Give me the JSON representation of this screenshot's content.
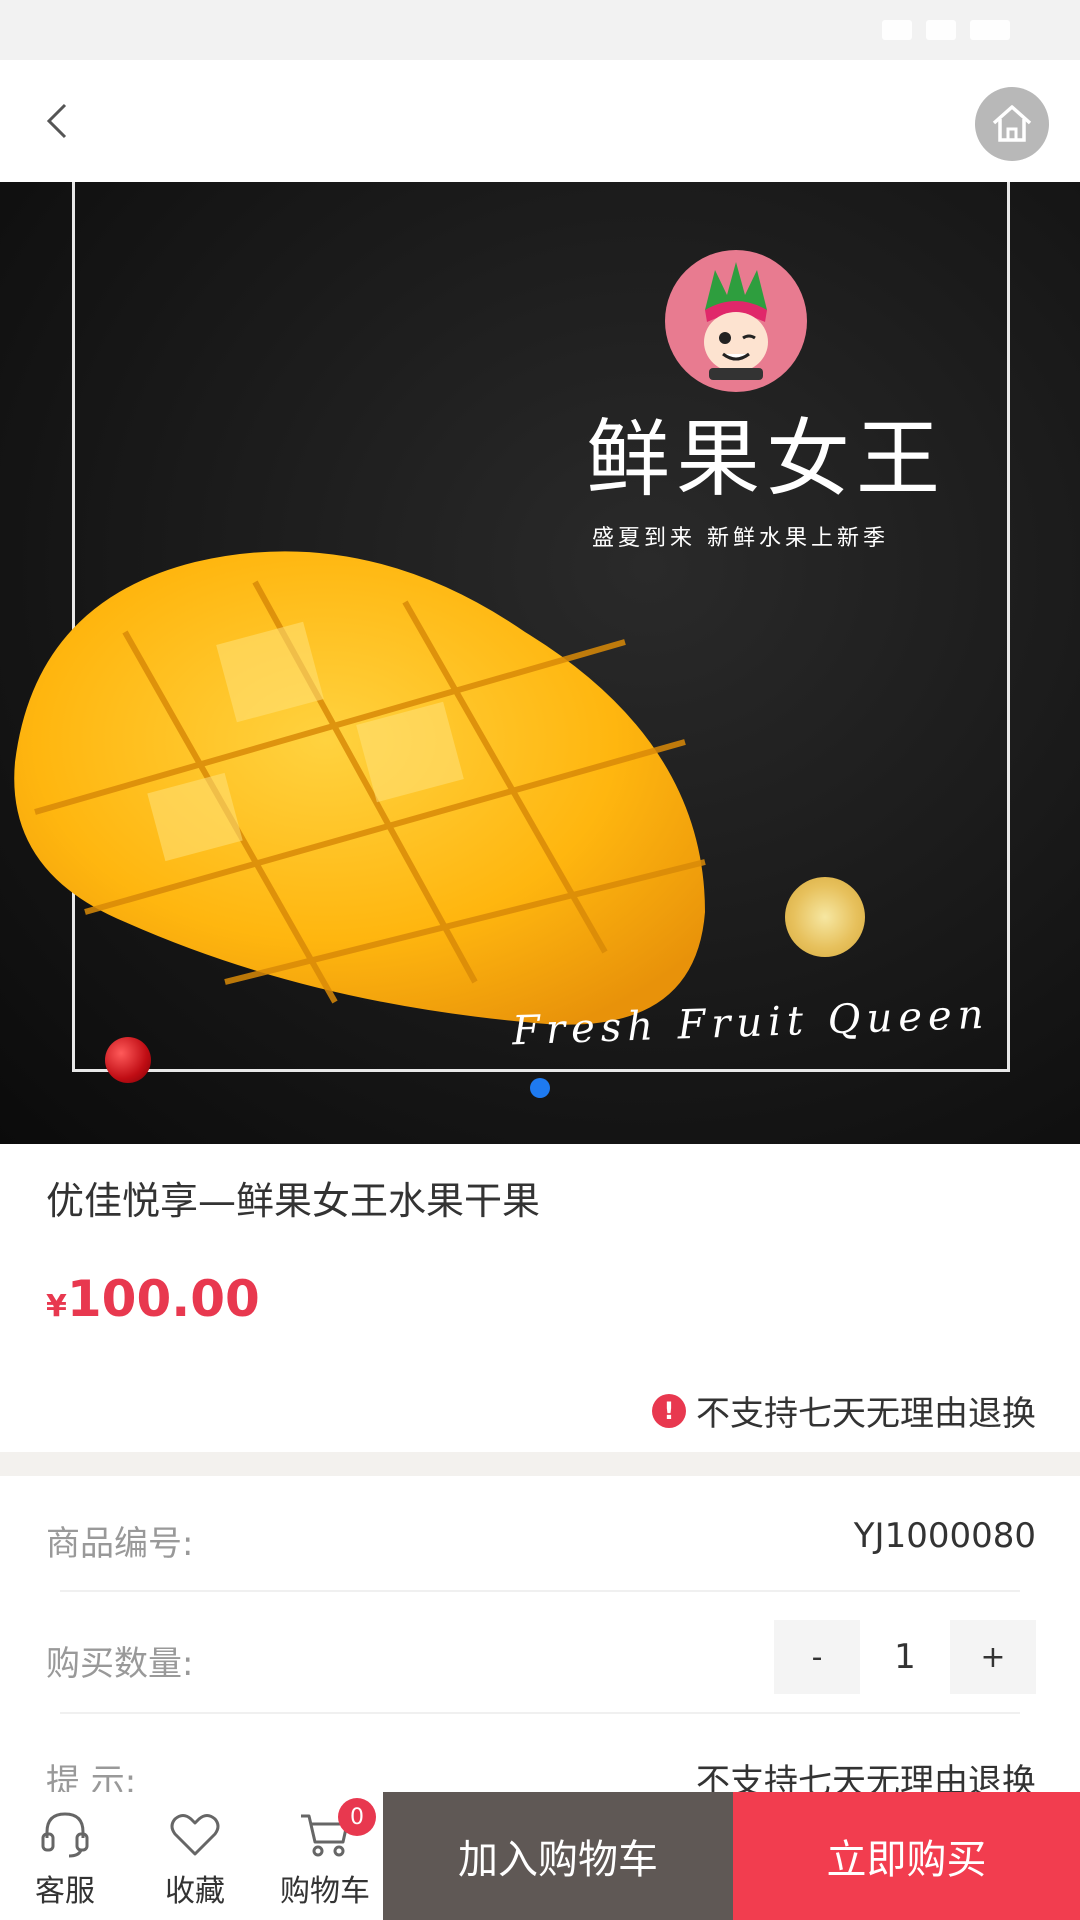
{
  "hero": {
    "brand_title": "鲜果女王",
    "brand_subtitle": "盛夏到来 新鲜水果上新季",
    "brand_english": "Fresh Fruit Queen"
  },
  "product": {
    "title": "优佳悦享—鲜果女王水果干果",
    "currency": "¥",
    "price": "100.00",
    "return_notice": "不支持七天无理由退换"
  },
  "details": {
    "sku_label": "商品编号:",
    "sku_value": "YJ1000080",
    "qty_label": "购买数量:",
    "qty_minus": "-",
    "qty_value": "1",
    "qty_plus": "+",
    "tip_label": "提 示:",
    "tip_value": "不支持七天无理由退换"
  },
  "bottom_bar": {
    "service_label": "客服",
    "favorite_label": "收藏",
    "cart_label": "购物车",
    "cart_count": "0",
    "add_to_cart": "加入购物车",
    "buy_now": "立即购买"
  },
  "colors": {
    "accent_red": "#e8384f",
    "buy_button": "#f23d4f",
    "cart_button": "#5f5855"
  },
  "icons": [
    "back-icon",
    "home-icon",
    "warning-icon",
    "headset-icon",
    "heart-icon",
    "cart-icon"
  ]
}
